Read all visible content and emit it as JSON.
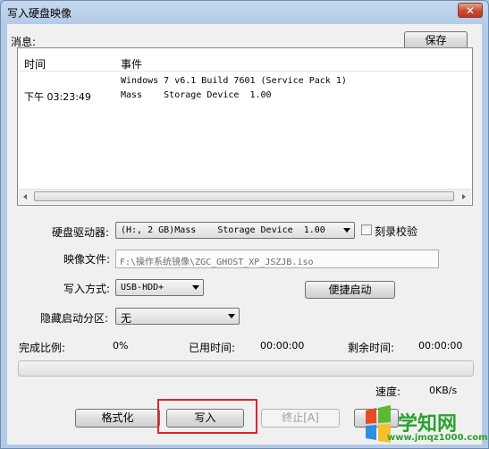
{
  "window": {
    "title": "写入硬盘映像",
    "close_glyph": "✕"
  },
  "messages": {
    "label": "消息:",
    "save_button": "保存",
    "col_time": "时间",
    "col_event": "事件",
    "rows": [
      {
        "time": "",
        "event": "Windows 7 v6.1 Build 7601 (Service Pack 1)"
      },
      {
        "time": "下午 03:23:49",
        "event": "Mass    Storage Device  1.00"
      }
    ]
  },
  "drive": {
    "label": "硬盘驱动器:",
    "value": "(H:, 2 GB)Mass    Storage Device  1.00",
    "verify_label": "刻录校验"
  },
  "image_file": {
    "label": "映像文件:",
    "value": "F:\\操作系统镜像\\ZGC_GHOST_XP_JSZJB.iso"
  },
  "write_mode": {
    "label": "写入方式:",
    "value": "USB-HDD+",
    "quick_boot_button": "便捷启动"
  },
  "hidden_partition": {
    "label": "隐藏启动分区:",
    "value": "无"
  },
  "progress": {
    "complete_label": "完成比例:",
    "complete_value": "0%",
    "elapsed_label": "已用时间:",
    "elapsed_value": "00:00:00",
    "remaining_label": "剩余时间:",
    "remaining_value": "00:00:00",
    "fraction": 0,
    "speed_label": "速度:",
    "speed_value": "0KB/s"
  },
  "buttons": {
    "format": "格式化",
    "write": "写入",
    "stop": "终止[A]"
  },
  "watermark": {
    "brand": "学知网",
    "url": "www.jmqz1000.com"
  },
  "colors": {
    "highlight_box": "#e0242a",
    "watermark_green": "#2aa12e"
  }
}
